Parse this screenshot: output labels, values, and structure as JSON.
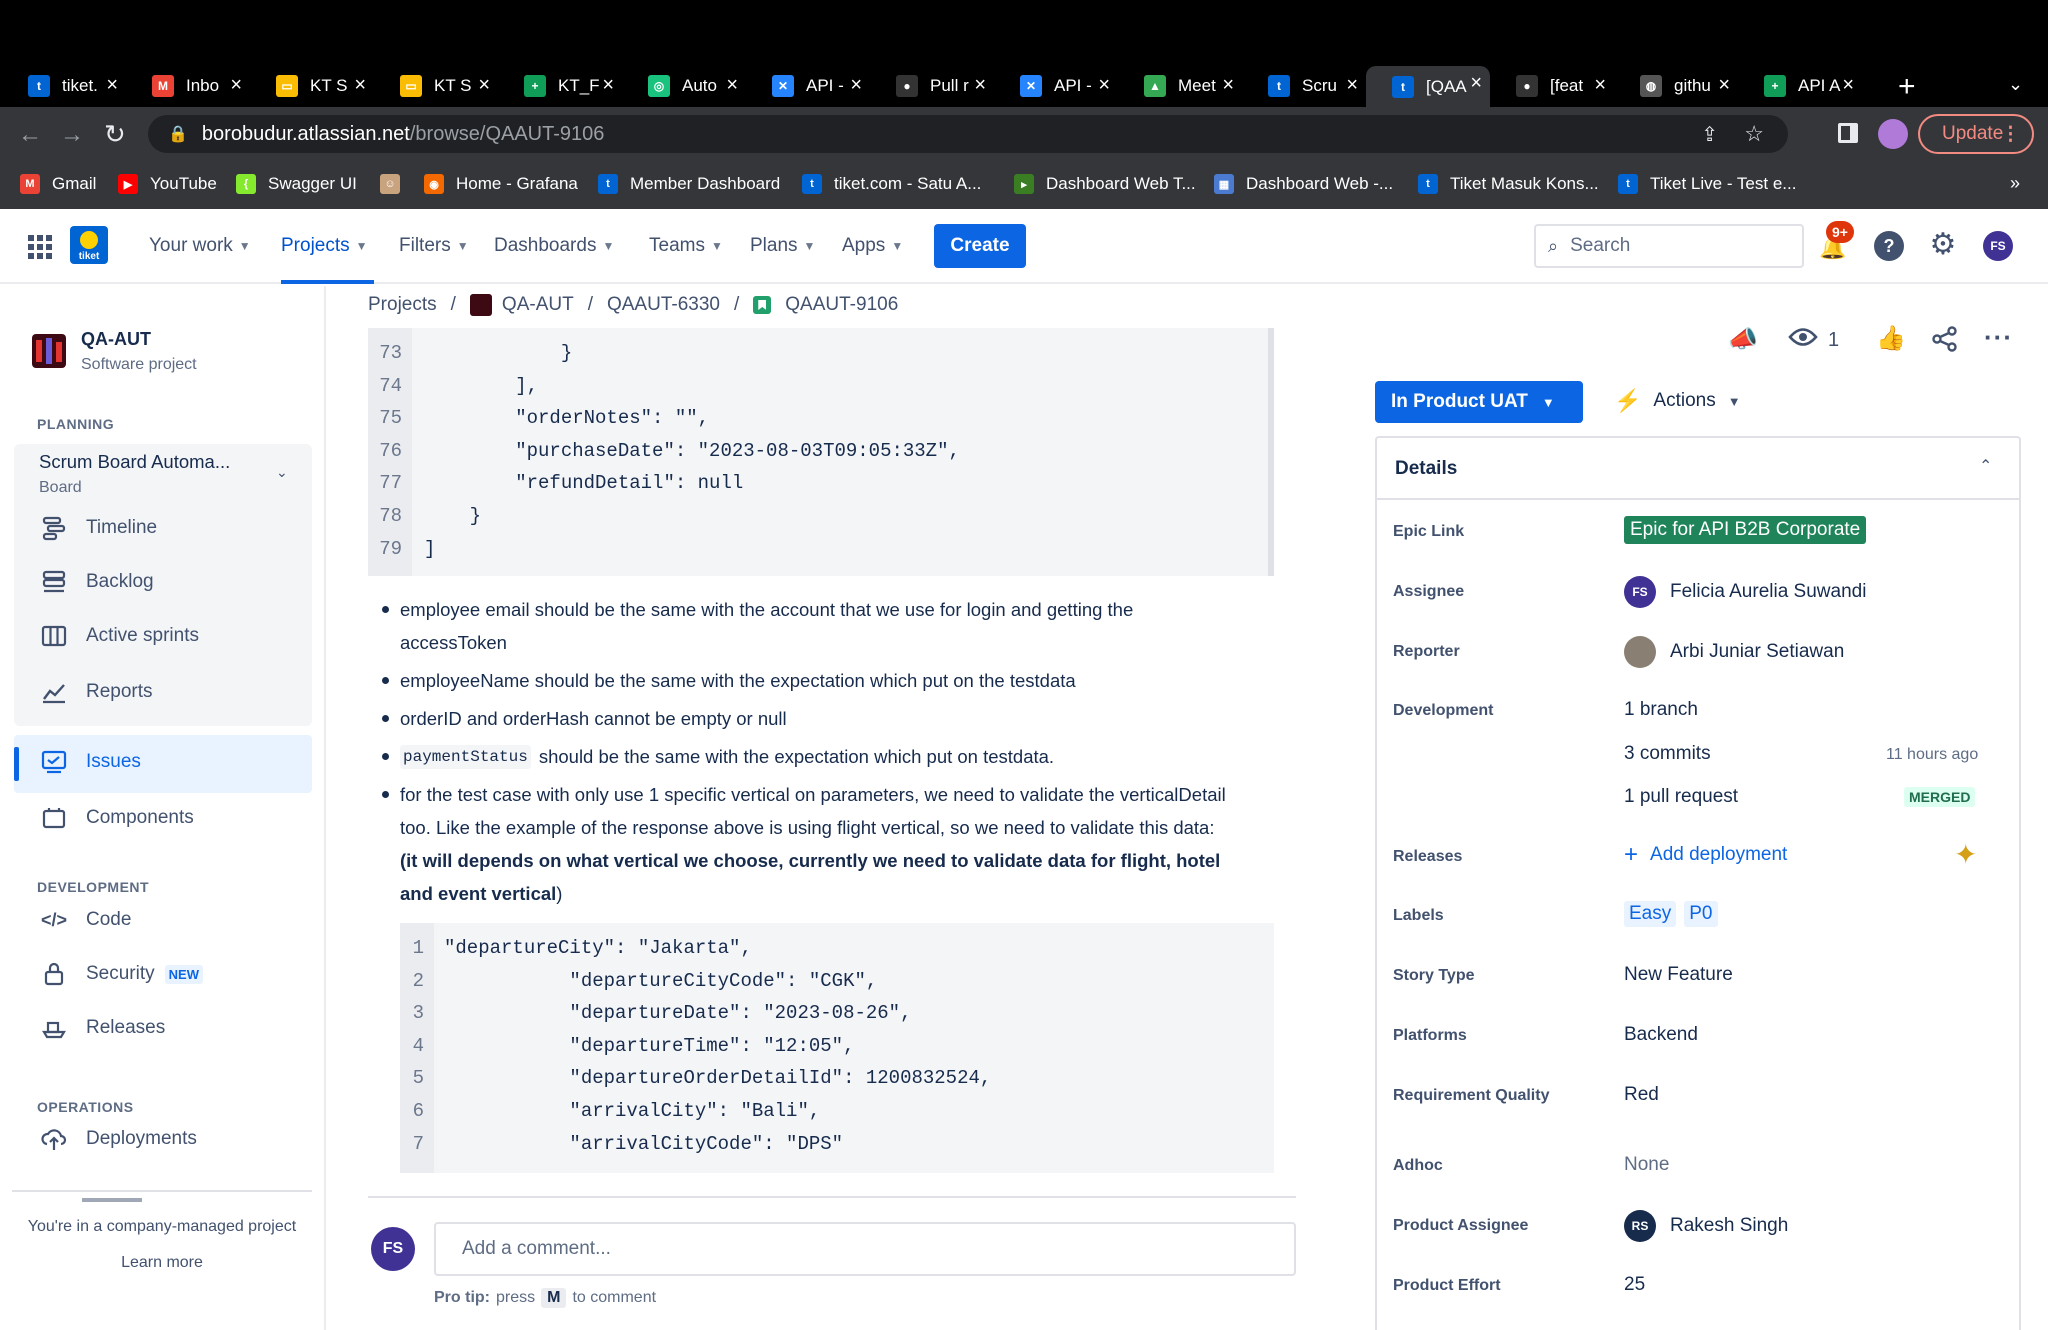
{
  "browser": {
    "tabs": [
      {
        "title": "tiket.",
        "color": "#0064d2",
        "glyph": "t"
      },
      {
        "title": "Inbo",
        "color": "#ea4335",
        "glyph": "M"
      },
      {
        "title": "KT S",
        "color": "#fbbc04",
        "glyph": "▭"
      },
      {
        "title": "KT S",
        "color": "#fbbc04",
        "glyph": "▭"
      },
      {
        "title": "KT_F",
        "color": "#0f9d58",
        "glyph": "+"
      },
      {
        "title": "Auto",
        "color": "#19c37d",
        "glyph": "◎"
      },
      {
        "title": "API -",
        "color": "#2684ff",
        "glyph": "✕"
      },
      {
        "title": "Pull r",
        "color": "#333",
        "glyph": "●"
      },
      {
        "title": "API -",
        "color": "#2684ff",
        "glyph": "✕"
      },
      {
        "title": "Meet",
        "color": "#34a853",
        "glyph": "▲"
      },
      {
        "title": "Scru",
        "color": "#0064d2",
        "glyph": "t"
      },
      {
        "title": "[QAA",
        "color": "#0064d2",
        "glyph": "t"
      },
      {
        "title": "[feat",
        "color": "#333",
        "glyph": "●"
      },
      {
        "title": "githu",
        "color": "#555",
        "glyph": "◍"
      },
      {
        "title": "API A",
        "color": "#0f9d58",
        "glyph": "+"
      }
    ],
    "url_host": "borobudur.atlassian.net",
    "url_path": "/browse/QAAUT-9106",
    "update_label": "Update",
    "bookmarks": [
      {
        "label": "Gmail",
        "color": "#ea4335",
        "glyph": "M"
      },
      {
        "label": "YouTube",
        "color": "#ff0000",
        "glyph": "▶"
      },
      {
        "label": "Swagger UI",
        "color": "#85ea2d",
        "glyph": "{"
      },
      {
        "label": "",
        "color": "#c9a27e",
        "glyph": "☺"
      },
      {
        "label": "Home - Grafana",
        "color": "#f46800",
        "glyph": "◉"
      },
      {
        "label": "Member Dashboard",
        "color": "#0064d2",
        "glyph": "t"
      },
      {
        "label": "tiket.com - Satu A...",
        "color": "#0064d2",
        "glyph": "t"
      },
      {
        "label": "Dashboard Web T...",
        "color": "#3b7d23",
        "glyph": "▸"
      },
      {
        "label": "Dashboard Web -...",
        "color": "#4a7bd0",
        "glyph": "▦"
      },
      {
        "label": "Tiket Masuk Kons...",
        "color": "#0064d2",
        "glyph": "t"
      },
      {
        "label": "Tiket Live - Test e...",
        "color": "#0064d2",
        "glyph": "t"
      }
    ],
    "more": "»"
  },
  "jira": {
    "logo": "tiket",
    "nav": [
      "Your work",
      "Projects",
      "Filters",
      "Dashboards",
      "Teams",
      "Plans",
      "Apps"
    ],
    "create": "Create",
    "search_placeholder": "Search",
    "notif_badge": "9+",
    "user_initials": "FS"
  },
  "sidebar": {
    "project_name": "QA-AUT",
    "project_type": "Software project",
    "planning": "PLANNING",
    "board_name": "Scrum Board Automa...",
    "board_sub": "Board",
    "items": [
      "Timeline",
      "Backlog",
      "Active sprints",
      "Reports",
      "Issues",
      "Components"
    ],
    "development": "DEVELOPMENT",
    "dev_items": [
      "Code",
      "Security",
      "Releases"
    ],
    "new_badge": "NEW",
    "operations": "OPERATIONS",
    "ops_items": [
      "Deployments"
    ],
    "footer_text": "You're in a company-managed project",
    "learn_more": "Learn more"
  },
  "breadcrumb": [
    "Projects",
    "QA-AUT",
    "QAAUT-6330",
    "QAAUT-9106"
  ],
  "code1": {
    "lines": [
      {
        "n": "73",
        "t": "            }"
      },
      {
        "n": "74",
        "t": "        ],"
      },
      {
        "n": "75",
        "t": "        \"orderNotes\": \"\","
      },
      {
        "n": "76",
        "t": "        \"purchaseDate\": \"2023-08-03T09:05:33Z\","
      },
      {
        "n": "77",
        "t": "        \"refundDetail\": null"
      },
      {
        "n": "78",
        "t": "    }"
      },
      {
        "n": "79",
        "t": "]"
      }
    ]
  },
  "bullets": {
    "b1a": "employee email should be the same with the account that we use for login and getting the",
    "b1b": "accessToken",
    "b2": "employeeName should be the same with the expectation which put on the testdata",
    "b3": "orderID and orderHash cannot be empty or null",
    "b4_code": "paymentStatus",
    "b4": "should be the same with the expectation which put on testdata.",
    "b5a": "for the test case with only use 1 specific vertical on parameters, we need to validate the verticalDetail",
    "b5b": "too. Like the example of the response above is using flight vertical, so we need to validate this data:",
    "b5c_open": "(",
    "b5c_bold": "it will depends on what vertical we choose, currently we need to validate data for flight, hotel",
    "b5d_bold": "and event vertical",
    "b5d_close": ")"
  },
  "code2": {
    "lines": [
      {
        "n": "1",
        "t": "\"departureCity\": \"Jakarta\","
      },
      {
        "n": "2",
        "t": "           \"departureCityCode\": \"CGK\","
      },
      {
        "n": "3",
        "t": "           \"departureDate\": \"2023-08-26\","
      },
      {
        "n": "4",
        "t": "           \"departureTime\": \"12:05\","
      },
      {
        "n": "5",
        "t": "           \"departureOrderDetailId\": 1200832524,"
      },
      {
        "n": "6",
        "t": "           \"arrivalCity\": \"Bali\","
      },
      {
        "n": "7",
        "t": "           \"arrivalCityCode\": \"DPS\""
      }
    ]
  },
  "comment": {
    "initials": "FS",
    "placeholder": "Add a comment...",
    "tip_prefix": "Pro tip:",
    "tip_press": "press",
    "tip_key": "M",
    "tip_suffix": "to comment"
  },
  "issue": {
    "watch_count": "1",
    "status": "In Product UAT",
    "actions": "Actions",
    "details_title": "Details",
    "labels": {
      "epic": "Epic Link",
      "assignee": "Assignee",
      "reporter": "Reporter",
      "development": "Development",
      "releases": "Releases",
      "labels": "Labels",
      "story_type": "Story Type",
      "platforms": "Platforms",
      "req_quality": "Requirement Quality",
      "adhoc": "Adhoc",
      "product_assignee": "Product Assignee",
      "product_effort": "Product Effort"
    },
    "epic": "Epic for API B2B Corporate",
    "epic_color": "#1f845a",
    "assignee": "Felicia Aurelia Suwandi",
    "assignee_initials": "FS",
    "reporter": "Arbi Juniar Setiawan",
    "branch": "1 branch",
    "commits": "3 commits",
    "commits_time": "11 hours ago",
    "pull_request": "1 pull request",
    "merged": "MERGED",
    "add_deployment": "Add deployment",
    "label_items": [
      "Easy",
      "P0"
    ],
    "story_type": "New Feature",
    "platforms": "Backend",
    "req_quality": "Red",
    "adhoc": "None",
    "product_assignee": "Rakesh Singh",
    "product_assignee_initials": "RS",
    "product_effort": "25"
  }
}
